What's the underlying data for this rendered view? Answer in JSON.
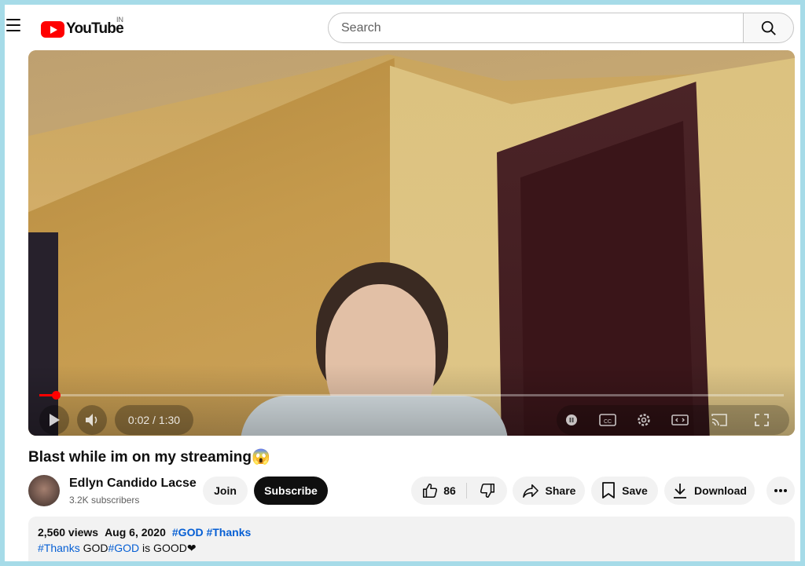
{
  "header": {
    "logo_text": "YouTube",
    "country_code": "IN",
    "search_placeholder": "Search"
  },
  "player": {
    "time_display": "0:02 / 1:30",
    "progress_fraction": 0.022,
    "accent_color": "#ff0000"
  },
  "video": {
    "title": "Blast while im on my streaming😱",
    "channel_name": "Edlyn Candido Lacse",
    "subscribers": "3.2K subscribers",
    "join_label": "Join",
    "subscribe_label": "Subscribe",
    "like_count": "86",
    "share_label": "Share",
    "save_label": "Save",
    "download_label": "Download"
  },
  "description": {
    "views": "2,560 views",
    "date": "Aug 6, 2020",
    "meta_tags": [
      "#GOD",
      "#Thanks"
    ],
    "line_tag_1": "#Thanks",
    "line_text_1": " GOD",
    "line_tag_2": "#GOD",
    "line_text_2": " is GOOD❤"
  }
}
